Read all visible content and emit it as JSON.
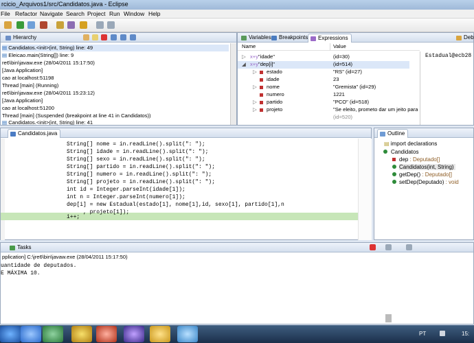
{
  "window": {
    "title": "rcicio_Arquivos1/src/Candidatos.java - Eclipse"
  },
  "menu": [
    "File",
    "Refactor",
    "Navigate",
    "Search",
    "Project",
    "Run",
    "Window",
    "Help"
  ],
  "debug_view": {
    "tab_label": "Hierarchy",
    "lines": [
      "Candidatos.<init>(int, String) line: 49",
      "Eleicao.main(String[]) line: 9",
      "re6\\bin\\javaw.exe (28/04/2011 15:17:50)",
      "[Java Application]",
      "cao at localhost:51198",
      "Thread [main] (Running)",
      "re6\\bin\\javaw.exe (28/04/2011 15:23:12)",
      "[Java Application]",
      "cao at localhost:51200",
      "Thread [main] (Suspended (breakpoint at line 41 in Candidatos))",
      "Candidatos.<init>(int, String) line: 41"
    ]
  },
  "variables_view": {
    "tabs": [
      "Variables",
      "Breakpoints",
      "Expressions",
      "Debu"
    ],
    "col_name": "Name",
    "col_value": "Value",
    "rows": [
      {
        "name": "\"idade\"",
        "value": "(id=30)",
        "indent": 0
      },
      {
        "name": "\"dep[i]\"",
        "value": "(id=514)",
        "indent": 0
      },
      {
        "name": "estado",
        "value": "\"RS\" (id=27)",
        "indent": 1
      },
      {
        "name": "idade",
        "value": "23",
        "indent": 1
      },
      {
        "name": "nome",
        "value": "\"Gremista\" (id=29)",
        "indent": 1
      },
      {
        "name": "numero",
        "value": "1221",
        "indent": 1
      },
      {
        "name": "partido",
        "value": "\"PCO\" (id=518)",
        "indent": 1
      },
      {
        "name": "projeto",
        "value": "\"Se eleito, prometo dar um jeito para",
        "indent": 1
      }
    ],
    "detail": "Estadual@ecb28",
    "partial_row": "(id=520)"
  },
  "editor": {
    "tab_label": "Candidatos.java",
    "lines": [
      "String[] nome = in.readLine().split(\": \");",
      "String[] idade = in.readLine().split(\": \");",
      "String[] sexo = in.readLine().split(\": \");",
      "String[] partido = in.readLine().split(\": \");",
      "String[] numero = in.readLine().split(\": \");",
      "String[] projeto = in.readLine().split(\": \");",
      "int id = Integer.parseInt(idade[1]);",
      "int n = Integer.parseInt(numero[1]);",
      "dep[i] = new Estadual(estado[1], nome[1],id, sexo[1], partido[1],n",
      "     , projeto[1]);",
      "i++;"
    ]
  },
  "outline": {
    "tab_label": "Outline",
    "items": [
      {
        "label": "import declarations",
        "type": ""
      },
      {
        "label": "Candidatos",
        "type": ""
      },
      {
        "label": "dep",
        "type": " : Deputado[]"
      },
      {
        "label": "Candidatos(int, String)",
        "type": ""
      },
      {
        "label": "getDep()",
        "type": " : Deputado[]"
      },
      {
        "label": "setDep(Deputado)",
        "type": " : void"
      }
    ]
  },
  "console": {
    "tab_label": "Tasks",
    "header": "pplication] C:\\jre6\\bin\\javaw.exe (28/04/2011 15:17:50)",
    "lines": [
      "uantidade de deputados.",
      "E MÁXIMA 10."
    ]
  },
  "taskbar": {
    "lang": "PT",
    "time": "15:"
  },
  "colors": {
    "accent": "#3399ff",
    "keyword": "#7f0055",
    "current_line": "#c7e6b8"
  }
}
